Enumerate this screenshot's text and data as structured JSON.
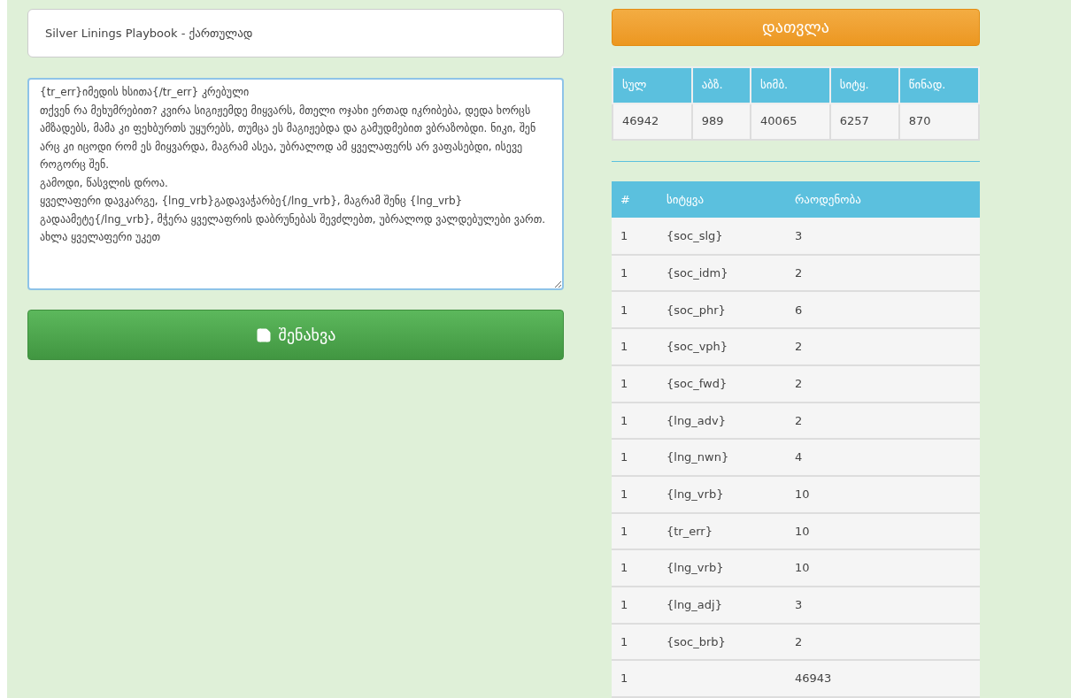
{
  "title_field": {
    "value": "Silver Linings Playbook - ქართულად"
  },
  "text_area": {
    "value": "{tr_err}იმედის ხსითა{/tr_err} კრებული\nთქვენ რა მეხუმრებით? კვირა სიგიჟემდე მიყვარს, მთელი ოჯახი ერთად იკრიბება, დედა ხორცს ამზადებს, მამა კი ფეხბურთს უყურებს, თუმცა ეს მაგიჟებდა და გამუდმებით ვბრაზობდი. ნიკი, შენ არც კი იცოდი რომ ეს მიყვარდა, მაგრამ ასეა, უბრალოდ ამ ყველაფერს არ ვაფასებდი, ისევე როგორც შენ.\nგამოდი, წასვლის დროა.\nყველაფერი დავკარგე, {lng_vrb}გადავაჭარბე{/lng_vrb}, მაგრამ შენც {lng_vrb}გადაამეტე{/lng_vrb}, მჭერა ყველაფრის დაბრუნებას შევძლებთ, უბრალოდ ვალდებულები ვართ. ახლა ყველაფერი უკეთ"
  },
  "save_button": {
    "label": "შენახვა"
  },
  "count_button": {
    "label": "დათვლა"
  },
  "stats_table": {
    "columns": [
      "სულ",
      "აბზ.",
      "სიმბ.",
      "სიტყ.",
      "წინად."
    ],
    "row": [
      "46942",
      "989",
      "40065",
      "6257",
      "870"
    ]
  },
  "words_table": {
    "columns": [
      "#",
      "სიტყვა",
      "რაოდენობა"
    ],
    "rows": [
      [
        "1",
        "{soc_slg}",
        "3"
      ],
      [
        "1",
        "{soc_idm}",
        "2"
      ],
      [
        "1",
        "{soc_phr}",
        "6"
      ],
      [
        "1",
        "{soc_vph}",
        "2"
      ],
      [
        "1",
        "{soc_fwd}",
        "2"
      ],
      [
        "1",
        "{lng_adv}",
        "2"
      ],
      [
        "1",
        "{lng_nwn}",
        "4"
      ],
      [
        "1",
        "{lng_vrb}",
        "10"
      ],
      [
        "1",
        "{tr_err}",
        "10"
      ],
      [
        "1",
        "{lng_vrb}",
        "10"
      ],
      [
        "1",
        "{lng_adj}",
        "3"
      ],
      [
        "1",
        "{soc_brb}",
        "2"
      ],
      [
        "1",
        "",
        "46943"
      ]
    ]
  }
}
